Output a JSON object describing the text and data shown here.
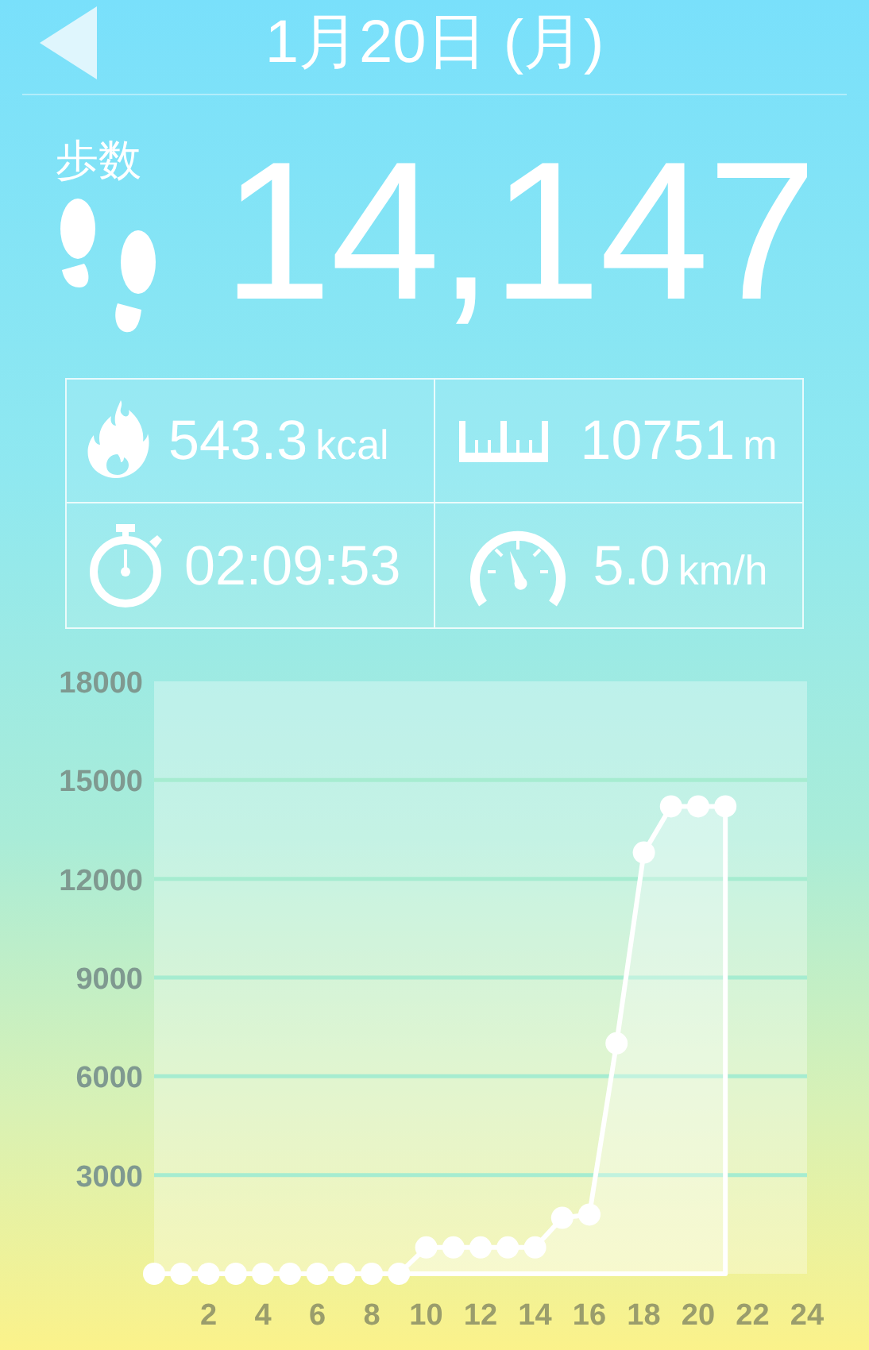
{
  "header": {
    "title": "1月20日 (月)"
  },
  "steps": {
    "label": "歩数",
    "value": "14,147"
  },
  "stats": [
    {
      "kind": "calories",
      "value": "543.3",
      "unit": "kcal"
    },
    {
      "kind": "distance",
      "value": "10751",
      "unit": "m"
    },
    {
      "kind": "duration",
      "value": "02:09:53"
    },
    {
      "kind": "speed",
      "value": "5.0",
      "unit": "km/h"
    }
  ],
  "chart": {
    "chart_data": {
      "type": "area",
      "x": [
        0,
        1,
        2,
        3,
        4,
        5,
        6,
        7,
        8,
        9,
        10,
        11,
        12,
        13,
        14,
        15,
        16,
        17,
        18,
        19,
        20,
        21
      ],
      "series": [
        {
          "color": "#ffffff",
          "values": [
            0,
            0,
            0,
            0,
            0,
            0,
            0,
            0,
            0,
            0,
            800,
            800,
            800,
            800,
            800,
            1700,
            1800,
            7000,
            12800,
            14200,
            14200,
            14200
          ]
        }
      ],
      "grid": true,
      "xlim": [
        0,
        24
      ],
      "ylim": [
        0,
        18000
      ],
      "xticks": [
        2,
        4,
        6,
        8,
        10,
        12,
        14,
        16,
        18,
        20,
        22,
        24
      ],
      "yticks": [
        3000,
        6000,
        9000,
        12000,
        15000,
        18000
      ]
    }
  }
}
